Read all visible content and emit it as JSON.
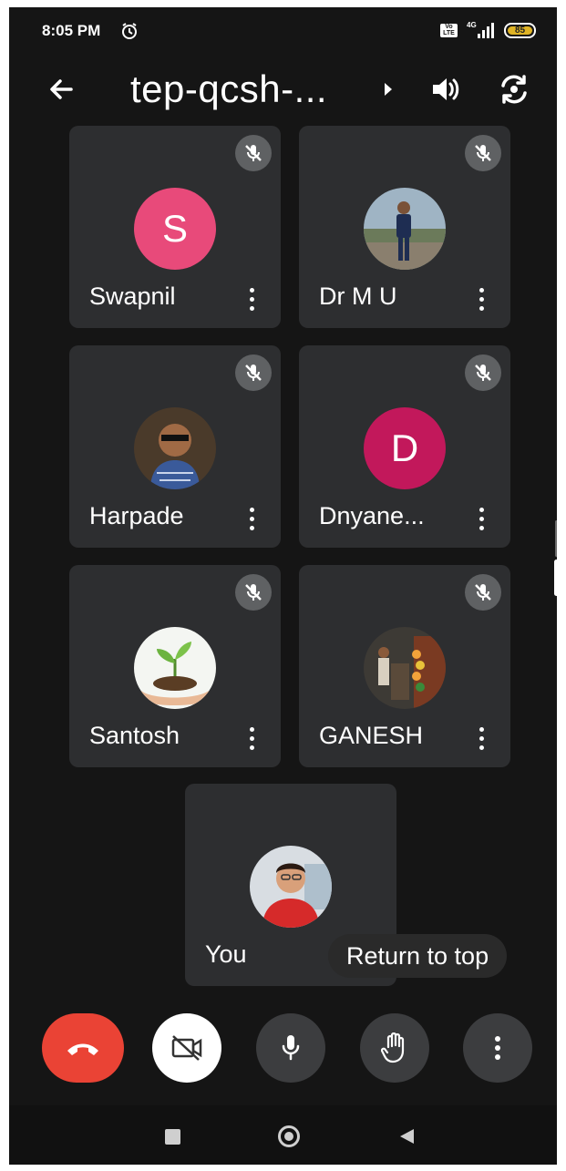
{
  "status_bar": {
    "time": "8:05 PM",
    "volte": "Vo LTE",
    "network": "4G",
    "battery": "85"
  },
  "header": {
    "title": "tep-qcsh-..."
  },
  "participants": [
    {
      "name": "Swapnil",
      "initial": "S",
      "avatar_color": "#e84a7a",
      "muted": true
    },
    {
      "name": "Dr M U",
      "initial": "",
      "muted": true
    },
    {
      "name": "Harpade",
      "initial": "",
      "muted": true
    },
    {
      "name": "Dnyane...",
      "initial": "D",
      "avatar_color": "#c2185b",
      "muted": true
    },
    {
      "name": "Santosh",
      "initial": "",
      "muted": true
    },
    {
      "name": "GANESH",
      "initial": "",
      "muted": true
    }
  ],
  "self_tile": {
    "name": "You"
  },
  "return_to_top": "Return to top",
  "colors": {
    "background": "#151515",
    "tile": "#2d2e30",
    "end_call": "#ea4335"
  },
  "icons": [
    "back-arrow-icon",
    "chevron-right-icon",
    "speaker-icon",
    "camera-flip-icon",
    "mic-off-icon",
    "more-vert-icon",
    "end-call-icon",
    "camera-off-icon",
    "mic-icon",
    "raise-hand-icon"
  ]
}
